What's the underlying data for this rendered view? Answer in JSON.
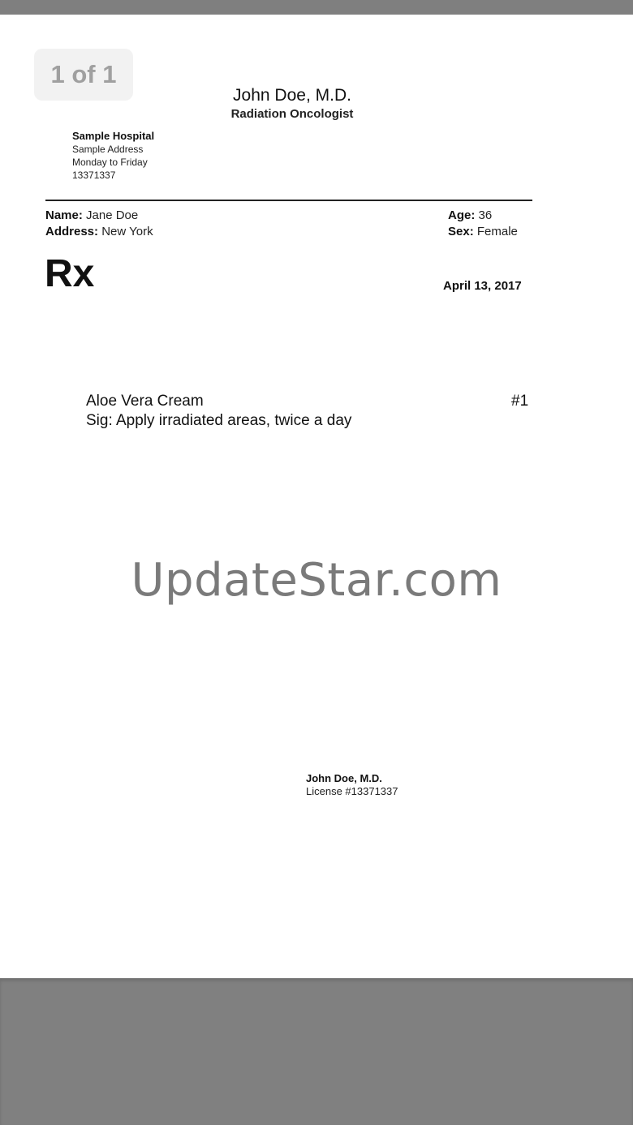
{
  "viewer": {
    "page_indicator": "1 of 1",
    "watermark": "UpdateStar.com"
  },
  "doctor": {
    "name": "John Doe, M.D.",
    "specialty": "Radiation Oncologist"
  },
  "hospital": {
    "name": "Sample Hospital",
    "address": "Sample Address",
    "hours": "Monday to Friday",
    "phone": "13371337"
  },
  "patient": {
    "name_label": "Name:",
    "name": "Jane Doe",
    "address_label": "Address:",
    "address": "New York",
    "age_label": "Age:",
    "age": "36",
    "sex_label": "Sex:",
    "sex": "Female"
  },
  "prescription": {
    "symbol": "Rx",
    "date": "April 13, 2017",
    "medication": "Aloe Vera Cream",
    "sig": "Sig: Apply irradiated areas, twice a day",
    "number": "#1"
  },
  "signature": {
    "name": "John Doe, M.D.",
    "license": "License #13371337"
  },
  "colors": {
    "viewer_background": "#808080",
    "page_background": "#ffffff",
    "watermark": "#7a7a7a",
    "page_indicator_text": "#a0a0a0"
  }
}
